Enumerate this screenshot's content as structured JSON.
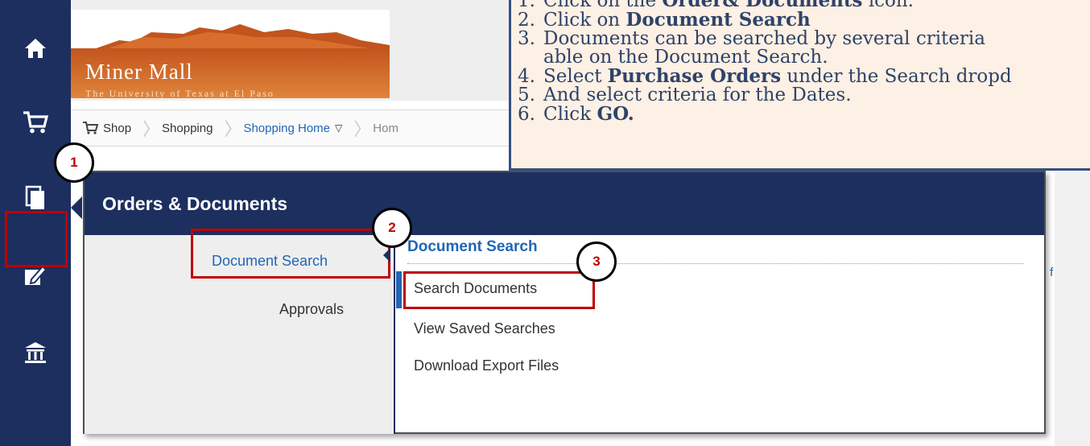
{
  "logo": {
    "title": "Miner Mall",
    "subtitle": "The University of Texas at El Paso"
  },
  "breadcrumb": {
    "items": [
      "Shop",
      "Shopping",
      "Shopping Home",
      "Hom"
    ]
  },
  "left_nav": {
    "icons": [
      "home-icon",
      "cart-icon",
      "documents-icon",
      "edit-icon",
      "institution-icon"
    ]
  },
  "instructions": {
    "steps": [
      {
        "num": "1.",
        "text": "Click on the ",
        "bold": "Order& Documents",
        "after": " icon."
      },
      {
        "num": "2.",
        "text": "Click on ",
        "bold": "Document Search",
        "after": ""
      },
      {
        "num": "3.",
        "text": "Documents can be searched by several criteria",
        "bold": "",
        "after": ""
      },
      {
        "num": "",
        "text": "able on the Document Search.",
        "bold": "",
        "after": ""
      },
      {
        "num": "4.",
        "text": "Select ",
        "bold": "Purchase Orders",
        "after": " under the Search dropd"
      },
      {
        "num": "5.",
        "text": "And select criteria for the Dates.",
        "bold": "",
        "after": ""
      },
      {
        "num": "6.",
        "text": "Click ",
        "bold": "GO.",
        "after": ""
      }
    ]
  },
  "flyout": {
    "title": "Orders & Documents",
    "menu": {
      "document_search": "Document Search",
      "approvals": "Approvals"
    },
    "section_title": "Document Search",
    "sub_items": [
      "Search Documents",
      "View Saved Searches",
      "Download Export Files"
    ]
  },
  "right_fragment": "es | f",
  "callouts": [
    "1",
    "2",
    "3"
  ],
  "colors": {
    "navy": "#1c2f5f",
    "highlight": "#c00000",
    "link": "#2166b5",
    "instruction_bg": "#fdf0e4"
  }
}
